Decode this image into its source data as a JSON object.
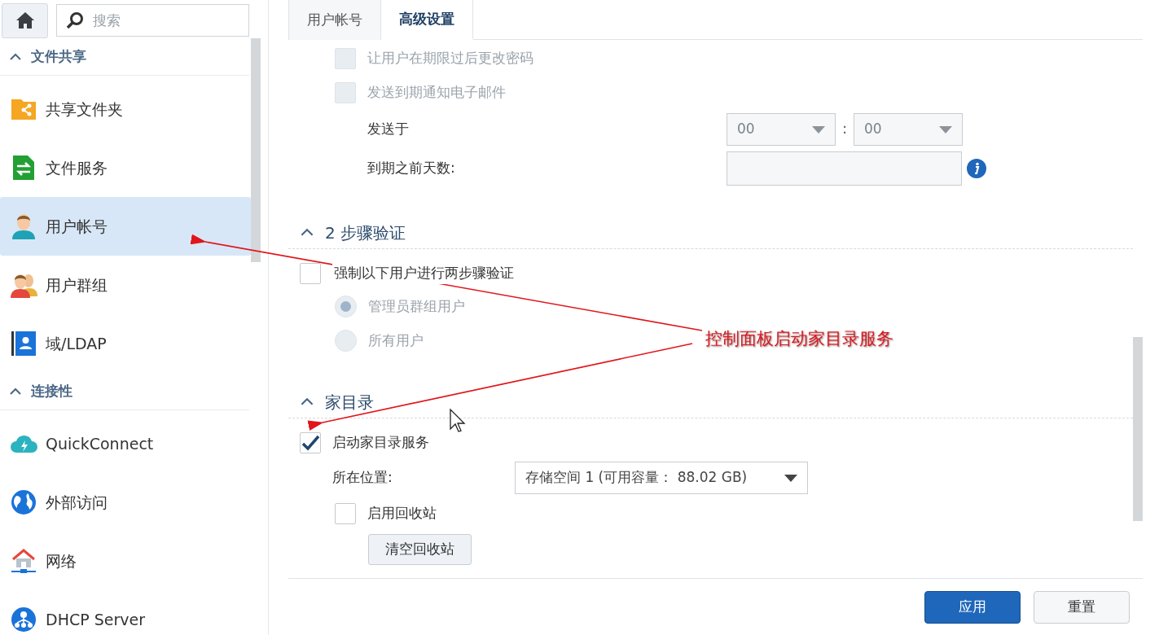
{
  "sidebar": {
    "search": {
      "placeholder": "搜索"
    },
    "groups": [
      {
        "title": "文件共享",
        "expanded": true,
        "items": [
          {
            "label": "共享文件夹",
            "kind": "shared-folder",
            "selected": false
          },
          {
            "label": "文件服务",
            "kind": "file-services",
            "selected": false
          },
          {
            "label": "用户帐号",
            "kind": "user",
            "selected": true
          },
          {
            "label": "用户群组",
            "kind": "group",
            "selected": false
          },
          {
            "label": "域/LDAP",
            "kind": "directory",
            "selected": false
          }
        ]
      },
      {
        "title": "连接性",
        "expanded": true,
        "items": [
          {
            "label": "QuickConnect",
            "kind": "cloud",
            "selected": false
          },
          {
            "label": "外部访问",
            "kind": "globe",
            "selected": false
          },
          {
            "label": "网络",
            "kind": "network",
            "selected": false
          },
          {
            "label": "DHCP Server",
            "kind": "dhcp",
            "selected": false
          }
        ]
      }
    ]
  },
  "tabs": [
    {
      "label": "用户帐号",
      "selected": false
    },
    {
      "label": "高级设置",
      "selected": true
    }
  ],
  "expiry": {
    "options": [
      {
        "label": "让用户在期限过后更改密码",
        "checked": false,
        "disabled": true
      },
      {
        "label": "发送到期通知电子邮件",
        "checked": false,
        "disabled": true
      }
    ],
    "send_at": {
      "label": "发送于",
      "hour": "00",
      "separator": ":",
      "minute": "00"
    },
    "days_before": {
      "label": "到期之前天数:"
    }
  },
  "two_step": {
    "title": "2 步骤验证",
    "expanded": true,
    "enforce": {
      "label": "强制以下用户进行两步骤验证",
      "checked": false
    },
    "options": [
      {
        "label": "管理员群组用户",
        "selected": true,
        "disabled": true
      },
      {
        "label": "所有用户",
        "selected": false,
        "disabled": true
      }
    ]
  },
  "home": {
    "title": "家目录",
    "expanded": true,
    "enable": {
      "label": "启动家目录服务",
      "checked": true
    },
    "location": {
      "label": "所在位置:",
      "value": "存储空间 1 (可用容量： 88.02 GB)"
    },
    "recycle": {
      "label": "启用回收站",
      "checked": false
    },
    "empty_button": "清空回收站"
  },
  "buttons": [
    {
      "label": "应用",
      "kind": "primary"
    },
    {
      "label": "重置",
      "kind": "secondary"
    }
  ],
  "annotation": {
    "text": "控制面板启动家目录服务"
  }
}
